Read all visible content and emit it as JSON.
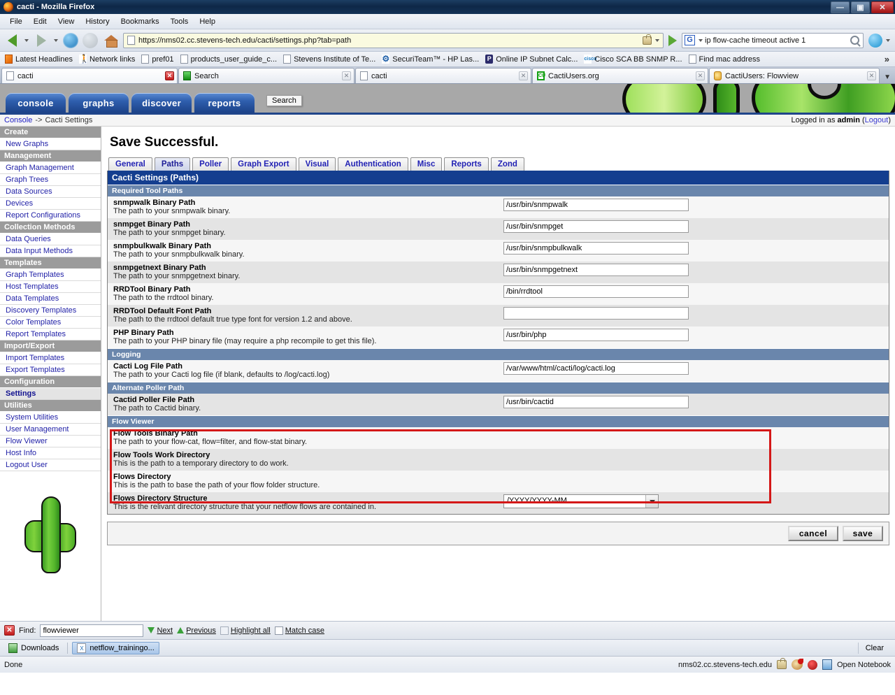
{
  "window": {
    "title": "cacti - Mozilla Firefox",
    "minimize": "—",
    "maximize": "▣",
    "close": "✕"
  },
  "menubar": [
    {
      "label": "File"
    },
    {
      "label": "Edit"
    },
    {
      "label": "View"
    },
    {
      "label": "History"
    },
    {
      "label": "Bookmarks"
    },
    {
      "label": "Tools"
    },
    {
      "label": "Help"
    }
  ],
  "navbar": {
    "url": "https://nms02.cc.stevens-tech.edu/cacti/settings.php?tab=path",
    "search_value": "ip flow-cache timeout active 1",
    "search_engine": "G",
    "back_icon": "back-arrow-icon",
    "forward_icon": "forward-arrow-icon",
    "reload_icon": "reload-icon",
    "stop_icon": "stop-icon",
    "home_icon": "home-icon",
    "go_icon": "go-icon",
    "lock_icon": "lock-icon"
  },
  "bookmarks": [
    {
      "label": "Latest Headlines",
      "icon": "rss-icon"
    },
    {
      "label": "Network links",
      "icon": "walker-icon"
    },
    {
      "label": "pref01",
      "icon": "page-icon"
    },
    {
      "label": "products_user_guide_c...",
      "icon": "page-icon"
    },
    {
      "label": "Stevens Institute of Te...",
      "icon": "page-icon"
    },
    {
      "label": "SecuriTeam™ - HP Las...",
      "icon": "securiteam-icon"
    },
    {
      "label": "Online IP Subnet Calc...",
      "icon": "p-icon"
    },
    {
      "label": "Cisco SCA BB SNMP R...",
      "icon": "cisco-icon"
    },
    {
      "label": "Find mac address",
      "icon": "page-icon"
    }
  ],
  "bookmarks_overflow": "»",
  "browser_tabs": [
    {
      "label": "cacti",
      "icon": "page-icon",
      "active": true,
      "close": "✕"
    },
    {
      "label": "Search",
      "icon": "search-tab-icon",
      "active": false,
      "close": "✕"
    },
    {
      "label": "cacti",
      "icon": "page-icon",
      "active": false,
      "close": "✕"
    },
    {
      "label": "CactiUsers.org",
      "icon": "cactiusers-icon",
      "active": false,
      "close": "✕"
    },
    {
      "label": "CactiUsers: Flowview",
      "icon": "flowview-icon",
      "active": false,
      "close": "✕"
    }
  ],
  "tooltip": {
    "text": "Search"
  },
  "cacti_header": {
    "tabs": [
      {
        "label": "console"
      },
      {
        "label": "graphs"
      },
      {
        "label": "discover"
      },
      {
        "label": "reports"
      }
    ]
  },
  "breadcrumb": {
    "root": "Console",
    "separator": "->",
    "current": "Cacti Settings",
    "logged_in_prefix": "Logged in as",
    "user": "admin",
    "logout_open": "(",
    "logout": "Logout",
    "logout_close": ")"
  },
  "sidebar": [
    {
      "type": "head",
      "label": "Create"
    },
    {
      "type": "item",
      "label": "New Graphs"
    },
    {
      "type": "head",
      "label": "Management"
    },
    {
      "type": "item",
      "label": "Graph Management"
    },
    {
      "type": "item",
      "label": "Graph Trees"
    },
    {
      "type": "item",
      "label": "Data Sources"
    },
    {
      "type": "item",
      "label": "Devices"
    },
    {
      "type": "item",
      "label": "Report Configurations"
    },
    {
      "type": "head",
      "label": "Collection Methods"
    },
    {
      "type": "item",
      "label": "Data Queries"
    },
    {
      "type": "item",
      "label": "Data Input Methods"
    },
    {
      "type": "head",
      "label": "Templates"
    },
    {
      "type": "item",
      "label": "Graph Templates"
    },
    {
      "type": "item",
      "label": "Host Templates"
    },
    {
      "type": "item",
      "label": "Data Templates"
    },
    {
      "type": "item",
      "label": "Discovery Templates"
    },
    {
      "type": "item",
      "label": "Color Templates"
    },
    {
      "type": "item",
      "label": "Report Templates"
    },
    {
      "type": "head",
      "label": "Import/Export"
    },
    {
      "type": "item",
      "label": "Import Templates"
    },
    {
      "type": "item",
      "label": "Export Templates"
    },
    {
      "type": "head",
      "label": "Configuration"
    },
    {
      "type": "item",
      "label": "Settings",
      "selected": true
    },
    {
      "type": "head",
      "label": "Utilities"
    },
    {
      "type": "item",
      "label": "System Utilities"
    },
    {
      "type": "item",
      "label": "User Management"
    },
    {
      "type": "item",
      "label": "Flow Viewer"
    },
    {
      "type": "item",
      "label": "Host Info"
    },
    {
      "type": "item",
      "label": "Logout User"
    }
  ],
  "main": {
    "save_message": "Save Successful.",
    "setting_tabs": [
      {
        "label": "General",
        "active": false
      },
      {
        "label": "Paths",
        "active": true
      },
      {
        "label": "Poller",
        "active": false
      },
      {
        "label": "Graph Export",
        "active": false
      },
      {
        "label": "Visual",
        "active": false
      },
      {
        "label": "Authentication",
        "active": false
      },
      {
        "label": "Misc",
        "active": false
      },
      {
        "label": "Reports",
        "active": false
      },
      {
        "label": "Zond",
        "active": false
      }
    ],
    "panel_title": "Cacti Settings (Paths)",
    "sections": [
      {
        "heading": "Required Tool Paths",
        "rows": [
          {
            "name": "snmpwalk Binary Path",
            "desc": "The path to your snmpwalk binary.",
            "value": "/usr/bin/snmpwalk",
            "control": "text"
          },
          {
            "name": "snmpget Binary Path",
            "desc": "The path to your snmpget binary.",
            "value": "/usr/bin/snmpget",
            "control": "text"
          },
          {
            "name": "snmpbulkwalk Binary Path",
            "desc": "The path to your snmpbulkwalk binary.",
            "value": "/usr/bin/snmpbulkwalk",
            "control": "text"
          },
          {
            "name": "snmpgetnext Binary Path",
            "desc": "The path to your snmpgetnext binary.",
            "value": "/usr/bin/snmpgetnext",
            "control": "text"
          },
          {
            "name": "RRDTool Binary Path",
            "desc": "The path to the rrdtool binary.",
            "value": "/bin/rrdtool",
            "control": "text"
          },
          {
            "name": "RRDTool Default Font Path",
            "desc": "The path to the rrdtool default true type font for version 1.2 and above.",
            "value": "",
            "control": "text"
          },
          {
            "name": "PHP Binary Path",
            "desc": "The path to your PHP binary file (may require a php recompile to get this file).",
            "value": "/usr/bin/php",
            "control": "text"
          }
        ]
      },
      {
        "heading": "Logging",
        "rows": [
          {
            "name": "Cacti Log File Path",
            "desc": "The path to your Cacti log file (if blank, defaults to /log/cacti.log)",
            "value": "/var/www/html/cacti/log/cacti.log",
            "control": "text"
          }
        ]
      },
      {
        "heading": "Alternate Poller Path",
        "rows": [
          {
            "name": "Cactid Poller File Path",
            "desc": "The path to Cactid binary.",
            "value": "/usr/bin/cactid",
            "control": "text"
          }
        ]
      },
      {
        "heading": "Flow Viewer",
        "highlighted": true,
        "rows": [
          {
            "name": "Flow Tools Binary Path",
            "desc": "The path to your flow-cat, flow=filter, and flow-stat binary.",
            "value": "",
            "control": "none"
          },
          {
            "name": "Flow Tools Work Directory",
            "desc": "This is the path to a temporary directory to do work.",
            "value": "",
            "control": "none"
          },
          {
            "name": "Flows Directory",
            "desc": "This is the path to base the path of your flow folder structure.",
            "value": "",
            "control": "none"
          },
          {
            "name": "Flows Directory Structure",
            "desc": "This is the relivant directory structure that your netflow flows are contained in.",
            "value": "/YYYY/YYYY-MM",
            "control": "select"
          }
        ]
      }
    ],
    "buttons": {
      "cancel": "cancel",
      "save": "save"
    }
  },
  "findbar": {
    "close_icon": "close-findbar-icon",
    "label": "Find:",
    "value": "flowviewer",
    "next": "Next",
    "previous": "Previous",
    "highlight_all": "Highlight all",
    "match_case": "Match case"
  },
  "downloadsbar": {
    "downloads_label": "Downloads",
    "item_label": "netflow_trainingo...",
    "clear_label": "Clear"
  },
  "statusbar": {
    "status": "Done",
    "host": "nms02.cc.stevens-tech.edu",
    "notebook": "Open Notebook",
    "icons": [
      "lock-icon",
      "torch-icon",
      "bug-icon",
      "notebook-icon"
    ]
  },
  "colors": {
    "panel_title_bg": "#143e8f",
    "section_head_bg": "#6a86ac",
    "sidebar_head_bg": "#9b9b9b",
    "link": "#2222a8",
    "highlight_red": "#d41818",
    "cacti_tab_blue": "#2f5fae"
  }
}
